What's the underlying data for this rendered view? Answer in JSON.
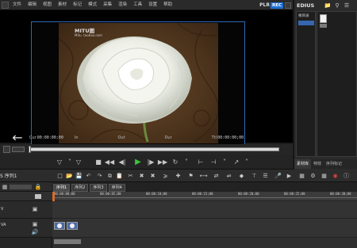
{
  "menu": {
    "items": [
      "文件",
      "编辑",
      "视图",
      "素材",
      "标记",
      "模式",
      "采集",
      "渲染",
      "工具",
      "设置",
      "帮助"
    ],
    "plr_label": "PLR",
    "rec_label": "REC"
  },
  "player": {
    "watermark": "MITU图",
    "watermark_sub": "Mitu. taobao.com",
    "timecodes": {
      "cur_label": "Cur",
      "cur_value": "00:00:00;00",
      "in_label": "In",
      "out_label": "Out",
      "dur_label": "Dur",
      "ttl_label": "Ttl",
      "ttl_value": "00:00:00;00"
    },
    "scrub_position": 0.0
  },
  "bin": {
    "title": "EDIUS",
    "tree_label": "根目录",
    "tabs": [
      "素材库",
      "特效",
      "序列标记"
    ]
  },
  "timeline": {
    "sequence_label": "S 序列1",
    "sequence_tabs": [
      "序列1",
      "序列2",
      "序列3",
      "序列4"
    ],
    "ruler_ticks": [
      "00:00:00;00",
      "00:00:05;00",
      "00:00:10;00",
      "00:00:15;00",
      "00:00:20;00",
      "00:00:25;00",
      "00:00:30;00"
    ],
    "cursor_tc": "00:00:11;00",
    "tracks": [
      {
        "name": "V"
      },
      {
        "name": "VA"
      }
    ]
  },
  "colors": {
    "monitor_border": "#2f67b8",
    "rec_badge": "#1e6fd3",
    "play_button": "#3cc43c"
  }
}
